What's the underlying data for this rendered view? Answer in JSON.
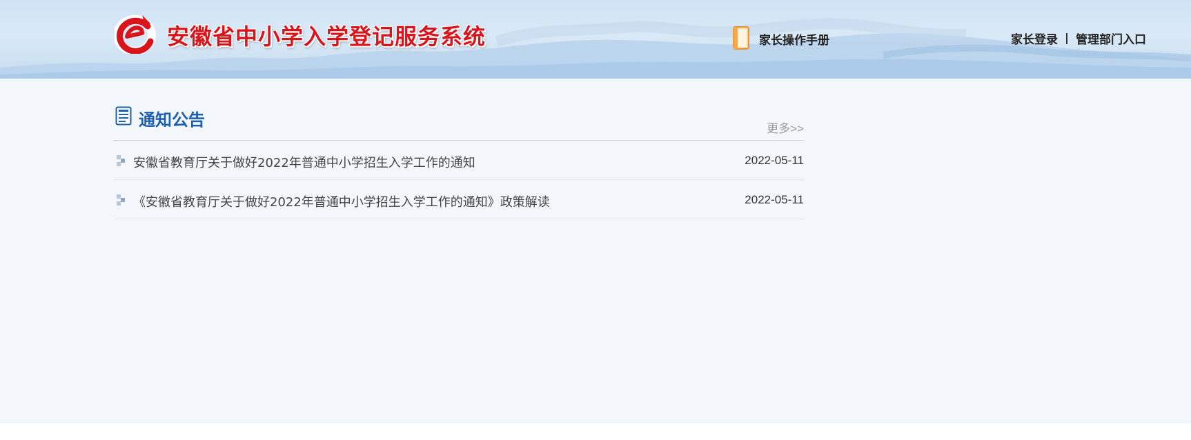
{
  "header": {
    "site_title": "安徽省中小学入学登记服务系统",
    "logo_icon": "e-logo-icon",
    "manual_icon": "document-icon",
    "manual_label": "家长操作手册",
    "parent_login_label": "家长登录",
    "admin_entry_label": "管理部门入口"
  },
  "notices": {
    "icon": "notice-list-icon",
    "title": "通知公告",
    "more_label": "更多>>",
    "items": [
      {
        "title": "安徽省教育厅关于做好2022年普通中小学招生入学工作的通知",
        "date": "2022-05-11"
      },
      {
        "title": "《安徽省教育厅关于做好2022年普通中小学招生入学工作的通知》政策解读",
        "date": "2022-05-11"
      }
    ]
  },
  "colors": {
    "brand_red": "#d9151b",
    "title_blue": "#1b5fae",
    "page_background": "#f3f7fc",
    "header_background": "#cfe3f5"
  }
}
